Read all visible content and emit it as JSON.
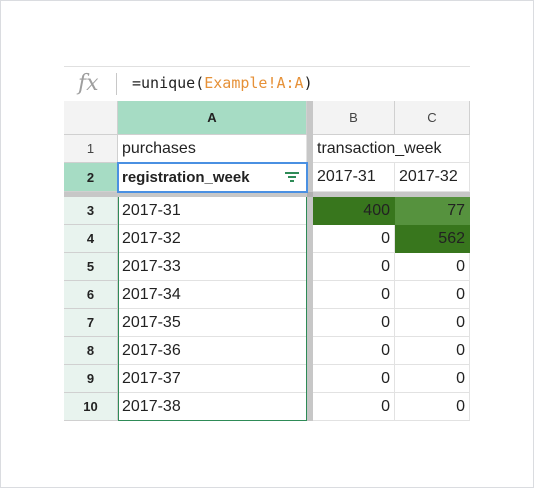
{
  "formula_bar": {
    "fx_label": "fx",
    "prefix": "=unique(",
    "reference": "Example!A:A",
    "suffix": ")"
  },
  "columns": [
    "A",
    "B",
    "C"
  ],
  "rows": [
    "1",
    "2",
    "3",
    "4",
    "5",
    "6",
    "7",
    "8",
    "9",
    "10"
  ],
  "row1": {
    "a": "purchases",
    "b": "transaction_week"
  },
  "row2": {
    "a": "registration_week",
    "b": "2017-31",
    "c": "2017-32"
  },
  "data_rows": [
    {
      "a": "2017-31",
      "b": "400",
      "c": "77"
    },
    {
      "a": "2017-32",
      "b": "0",
      "c": "562"
    },
    {
      "a": "2017-33",
      "b": "0",
      "c": "0"
    },
    {
      "a": "2017-34",
      "b": "0",
      "c": "0"
    },
    {
      "a": "2017-35",
      "b": "0",
      "c": "0"
    },
    {
      "a": "2017-36",
      "b": "0",
      "c": "0"
    },
    {
      "a": "2017-37",
      "b": "0",
      "c": "0"
    },
    {
      "a": "2017-38",
      "b": "0",
      "c": "0"
    }
  ],
  "colors": {
    "heat_dark": "#38761d",
    "heat_mid": "#56923e",
    "selection_header": "#a6dcc4",
    "selection_border": "#2e8b57",
    "formula_reference": "#e69138"
  }
}
